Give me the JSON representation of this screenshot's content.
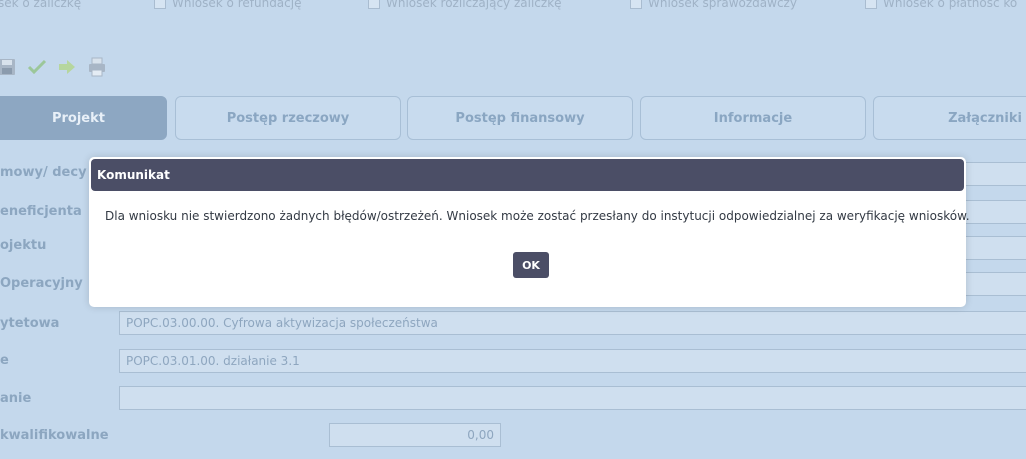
{
  "checkboxes": [
    {
      "label": "sek o zaliczkę"
    },
    {
      "label": "Wniosek o refundację"
    },
    {
      "label": "Wniosek rozliczający zaliczkę"
    },
    {
      "label": "Wniosek sprawozdawczy"
    },
    {
      "label": "Wniosek o płatność ko"
    }
  ],
  "toolbar": {
    "icons": [
      "save-icon",
      "check-icon",
      "arrow-right-icon",
      "print-icon"
    ]
  },
  "tabs": [
    {
      "label": "Projekt",
      "active": true
    },
    {
      "label": "Postęp rzeczowy",
      "active": false
    },
    {
      "label": "Postęp finansowy",
      "active": false
    },
    {
      "label": "Informacje",
      "active": false
    },
    {
      "label": "Załączniki",
      "active": false
    }
  ],
  "form": {
    "rows": [
      {
        "label": "mowy/ decy",
        "value": ""
      },
      {
        "label": "eneficjenta",
        "value": ""
      },
      {
        "label": "ojektu",
        "value": ""
      },
      {
        "label": "Operacyjny",
        "value": ""
      },
      {
        "label": "ytetowa",
        "value": "POPC.03.00.00. Cyfrowa aktywizacja społeczeństwa"
      },
      {
        "label": "e",
        "value": "POPC.03.01.00. działanie 3.1"
      },
      {
        "label": "anie",
        "value": ""
      },
      {
        "label": "kwalifikowalne",
        "value": "0,00"
      }
    ]
  },
  "modal": {
    "title": "Komunikat",
    "message": "Dla wniosku nie stwierdzono żadnych błędów/ostrzeżeń. Wniosek może zostać przesłany do instytucji odpowiedzialnej za weryfikację wniosków.",
    "ok_label": "OK"
  },
  "colors": {
    "overlay_bg": "#c4d8ec",
    "modal_header": "#4b4e66",
    "tab_active": "#8da7c2"
  }
}
